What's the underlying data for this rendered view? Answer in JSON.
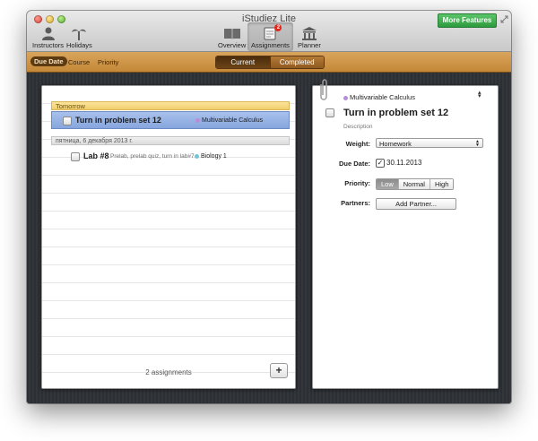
{
  "window": {
    "title": "iStudiez Lite"
  },
  "toolbar": {
    "more_features": "More Features",
    "left_buttons": [
      {
        "label": "Instructors",
        "icon": "person-icon"
      },
      {
        "label": "Holidays",
        "icon": "palm-tree-icon"
      }
    ],
    "center_buttons": [
      {
        "label": "Overview",
        "icon": "book-icon"
      },
      {
        "label": "Assignments",
        "icon": "assignments-icon",
        "badge": "2",
        "selected": true
      },
      {
        "label": "Planner",
        "icon": "building-icon"
      }
    ]
  },
  "sortbar": {
    "items": [
      {
        "label": "Due Date",
        "active": true
      },
      {
        "label": "Course"
      },
      {
        "label": "Priority"
      }
    ],
    "segments": [
      {
        "label": "Current",
        "selected": true
      },
      {
        "label": "Completed"
      }
    ]
  },
  "list": {
    "groups": [
      {
        "header": "Tomorrow",
        "tasks": [
          {
            "title": "Turn in problem set 12",
            "course": "Multivariable Calculus",
            "course_color": "#b78cd9",
            "selected": true
          }
        ]
      },
      {
        "header": "пятница, 6 декабря 2013 г.",
        "tasks": [
          {
            "title": "Lab #8",
            "description": "Prelab, prelab quiz, turn in lab#7",
            "course": "Biology 1",
            "course_color": "#6fc6d8"
          }
        ]
      }
    ],
    "footer": {
      "count_label": "2 assignments",
      "add_label": "+"
    }
  },
  "detail": {
    "course": "Multivariable Calculus",
    "course_color": "#b78cd9",
    "title": "Turn in problem set 12",
    "description_placeholder": "Description",
    "fields": {
      "weight_label": "Weight:",
      "weight_value": "Homework",
      "due_label": "Due Date:",
      "due_value": "30.11.2013",
      "due_checked": true,
      "priority_label": "Priority:",
      "priority_options": [
        "Low",
        "Normal",
        "High"
      ],
      "priority_selected": "Low",
      "partners_label": "Partners:",
      "add_partner": "Add Partner..."
    }
  }
}
